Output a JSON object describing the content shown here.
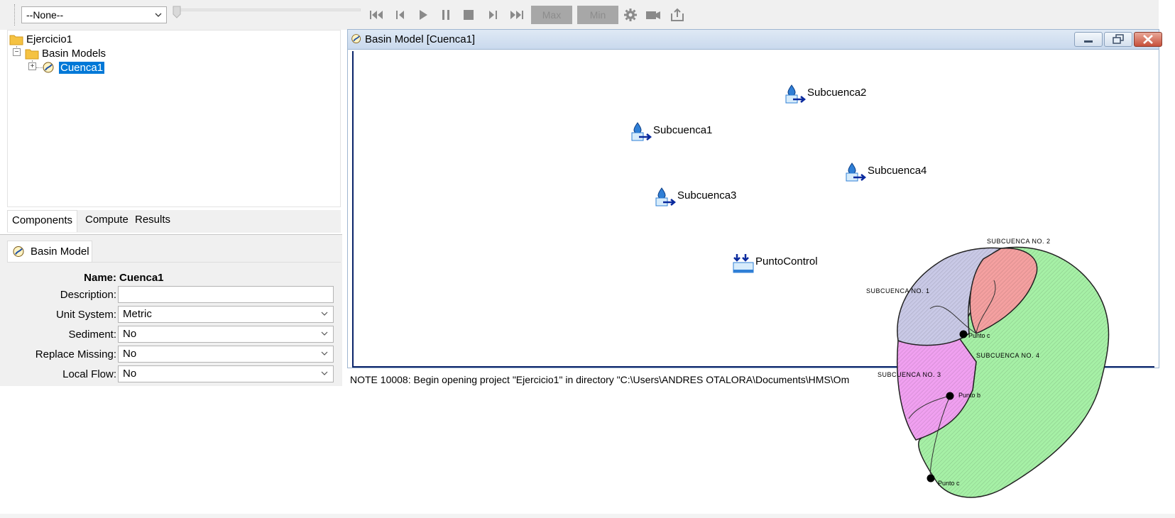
{
  "toolbar": {
    "run_select": "--None--",
    "max_label": "Max",
    "min_label": "Min",
    "icons": [
      "rewind-start-icon",
      "step-back-icon",
      "play-icon",
      "pause-icon",
      "stop-icon",
      "step-forward-icon",
      "fast-forward-end-icon",
      "gear-icon",
      "camera-icon",
      "export-icon"
    ]
  },
  "tree": {
    "project": "Ejercicio1",
    "basin_models": "Basin Models",
    "basin": "Cuenca1"
  },
  "tabs": [
    {
      "label": "Components",
      "active": true
    },
    {
      "label": "Compute",
      "active": false
    },
    {
      "label": "Results",
      "active": false
    }
  ],
  "properties": {
    "header": "Basin Model",
    "name_label": "Name:",
    "name_value": "Cuenca1",
    "description_label": "Description:",
    "description_value": "",
    "unit_system_label": "Unit System:",
    "unit_system_value": "Metric",
    "sediment_label": "Sediment:",
    "sediment_value": "No",
    "replace_missing_label": "Replace Missing:",
    "replace_missing_value": "No",
    "local_flow_label": "Local Flow:",
    "local_flow_value": "No"
  },
  "basin_window": {
    "title": "Basin Model [Cuenca1]",
    "elements": {
      "sub1": "Subcuenca1",
      "sub2": "Subcuenca2",
      "sub3": "Subcuenca3",
      "sub4": "Subcuenca4",
      "junction": "PuntoControl"
    }
  },
  "message": "NOTE 10008:  Begin opening project \"Ejercicio1\" in directory \"C:\\Users\\ANDRES OTALORA\\Documents\\HMS\\Om",
  "sketch": {
    "sub1": "SUBCUENCA  NO. 1",
    "sub2": "SUBCUENCA  NO. 2",
    "sub3": "SUBCUENCA  NO. 3",
    "sub4": "SUBCUENCA  NO. 4",
    "point_top": "Punto c",
    "point_mid": "Punto b",
    "point_bottom": "Punto c"
  },
  "colors": {
    "selection": "#0078d7",
    "sub1_fill": "#c9c9e6",
    "sub2_fill": "#f4a0a0",
    "sub3_fill": "#f0a0f0",
    "sub4_fill": "#a6f0a6"
  }
}
